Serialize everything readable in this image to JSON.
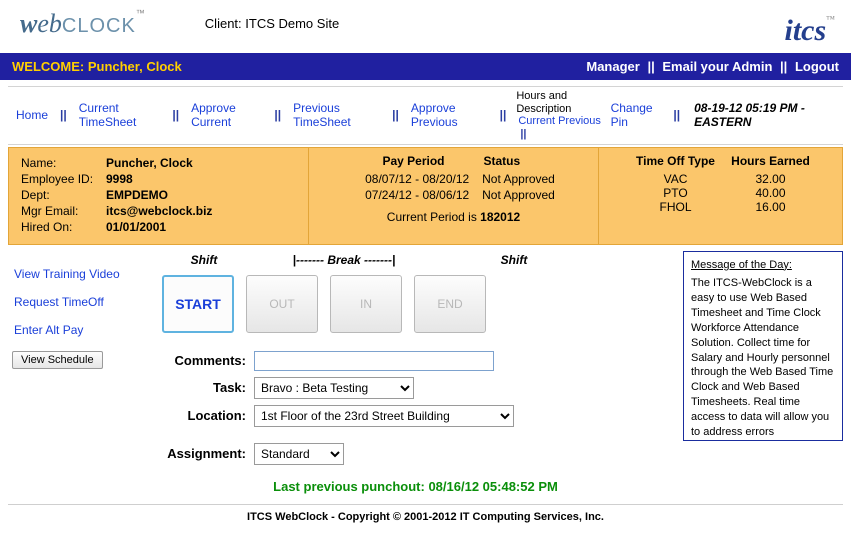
{
  "header": {
    "client_prefix": "Client: ",
    "client_name": "ITCS Demo Site"
  },
  "welcome": {
    "prefix": "WELCOME: ",
    "user": "Puncher, Clock",
    "manager": "Manager",
    "email_admin": "Email your Admin",
    "logout": "Logout"
  },
  "nav": {
    "home": "Home",
    "current_ts": "Current TimeSheet",
    "approve_current": "Approve Current",
    "previous_ts": "Previous TimeSheet",
    "approve_previous": "Approve Previous",
    "hours_desc": "Hours and Description",
    "current_previous": "Current Previous",
    "change_pin": "Change Pin",
    "timestamp": "08-19-12 05:19 PM - EASTERN"
  },
  "emp": {
    "name_label": "Name:",
    "name": "Puncher, Clock",
    "id_label": "Employee ID:",
    "id": "9998",
    "dept_label": "Dept:",
    "dept": "EMPDEMO",
    "mgr_label": "Mgr Email:",
    "mgr": "itcs@webclock.biz",
    "hired_label": "Hired On:",
    "hired": "01/01/2001"
  },
  "payperiod": {
    "head_period": "Pay Period",
    "head_status": "Status",
    "rows": [
      {
        "range": "08/07/12 - 08/20/12",
        "status": "Not Approved"
      },
      {
        "range": "07/24/12 - 08/06/12",
        "status": "Not Approved"
      }
    ],
    "current_prefix": "Current Period is ",
    "current": "182012"
  },
  "timeoff": {
    "head_type": "Time Off Type",
    "head_hours": "Hours Earned",
    "rows": [
      {
        "type": "VAC",
        "hours": "32.00"
      },
      {
        "type": "PTO",
        "hours": "40.00"
      },
      {
        "type": "FHOL",
        "hours": "16.00"
      }
    ]
  },
  "side": {
    "training": "View Training Video",
    "request": "Request TimeOff",
    "altpay": "Enter Alt Pay",
    "schedule": "View Schedule"
  },
  "shift": {
    "shift": "Shift",
    "break": "|------- Break -------|"
  },
  "punch": {
    "start": "START",
    "out": "OUT",
    "in": "IN",
    "end": "END"
  },
  "form": {
    "comments_label": "Comments:",
    "comments_value": "",
    "task_label": "Task:",
    "task_value": "Bravo : Beta Testing",
    "location_label": "Location:",
    "location_value": "1st Floor of the 23rd Street Building",
    "assignment_label": "Assignment:",
    "assignment_value": "Standard"
  },
  "last_punch": {
    "prefix": "Last previous punchout: ",
    "time": "08/16/12 05:48:52 PM"
  },
  "motd": {
    "title": "Message of the Day:",
    "body": "The ITCS-WebClock is a easy to use Web Based Timesheet and Time Clock Workforce Attendance Solution. Collect time for Salary and Hourly personnel through the Web Based Time Clock and Web Based Timesheets. Real time access to data will allow you to address errors immediately. The standard and audit reporting features enable managers and administrators to identify overtime situations and correct errors quickly."
  },
  "footer": "ITCS WebClock - Copyright © 2001-2012 IT Computing Services, Inc."
}
